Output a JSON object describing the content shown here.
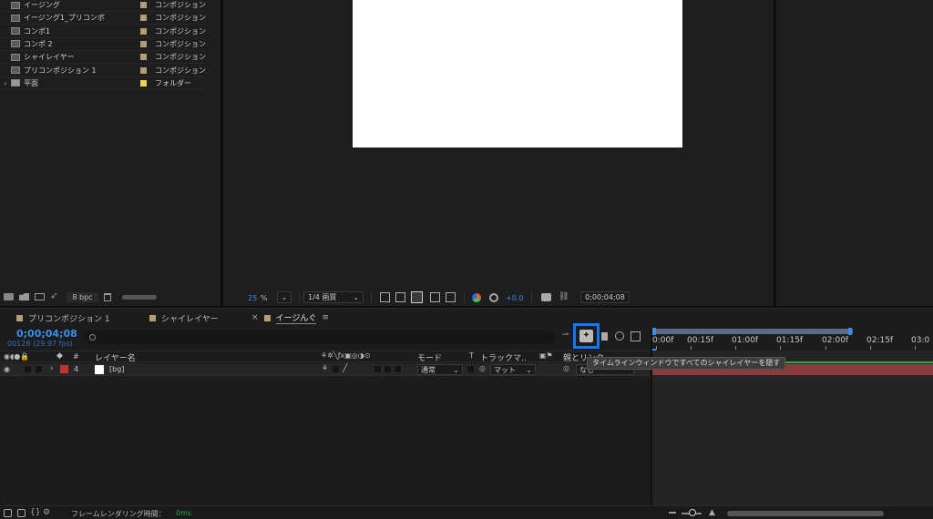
{
  "project": {
    "items": [
      {
        "name": "イージング",
        "type": "コンポジション",
        "color": "#b49c74"
      },
      {
        "name": "イージング1_プリコンポ",
        "type": "コンポジション",
        "color": "#b49c74"
      },
      {
        "name": "コンポ1",
        "type": "コンポジション",
        "color": "#b49c74"
      },
      {
        "name": "コンポ 2",
        "type": "コンポジション",
        "color": "#b49c74"
      },
      {
        "name": "シャイレイヤー",
        "type": "コンポジション",
        "color": "#b49c74"
      },
      {
        "name": "プリコンポジション 1",
        "type": "コンポジション",
        "color": "#b49c74"
      },
      {
        "name": "平面",
        "type": "フォルダー",
        "color": "#e8d44d"
      }
    ],
    "bpc_label": "8 bpc"
  },
  "viewer": {
    "zoom": "25",
    "zoom_unit": "%",
    "resolution": "1/4 画質",
    "exposure": "+0.0",
    "timecode": "0;00;04;08"
  },
  "tabs": [
    {
      "label": "プリコンポジション 1",
      "color": "#b49c74",
      "active": false
    },
    {
      "label": "シャイレイヤー",
      "color": "#b49c74",
      "active": false
    },
    {
      "label": "イージんぐ",
      "color": "#b49c74",
      "active": true
    }
  ],
  "tab_close": "×",
  "tab_menu": "≡",
  "timeline": {
    "current_time": "0;00;04;08",
    "frame_info": "00128 (29.97 fps)",
    "search_placeholder": "",
    "columns": {
      "hash": "#",
      "layer_name": "レイヤー名",
      "mode": "モード",
      "t": "T",
      "track_matte": "トラックマ..",
      "parent": "親とリンク"
    },
    "layers": [
      {
        "index": "4",
        "name": "[bg]",
        "label_color": "#c03232",
        "mode": "通常",
        "matte": "マット",
        "parent": "なし"
      }
    ],
    "ruler": [
      "0:00f",
      "00:15f",
      "01:00f",
      "01:15f",
      "02:00f",
      "02:15f",
      "03:0"
    ],
    "tooltip": "タイムラインウィンドウですべてのシャイレイヤーを隠す",
    "render_time_label": "フレームレンダリング時間：",
    "render_time_value": "0ms",
    "accent": "#2d8ceb",
    "highlight_color": "#1478ff"
  }
}
